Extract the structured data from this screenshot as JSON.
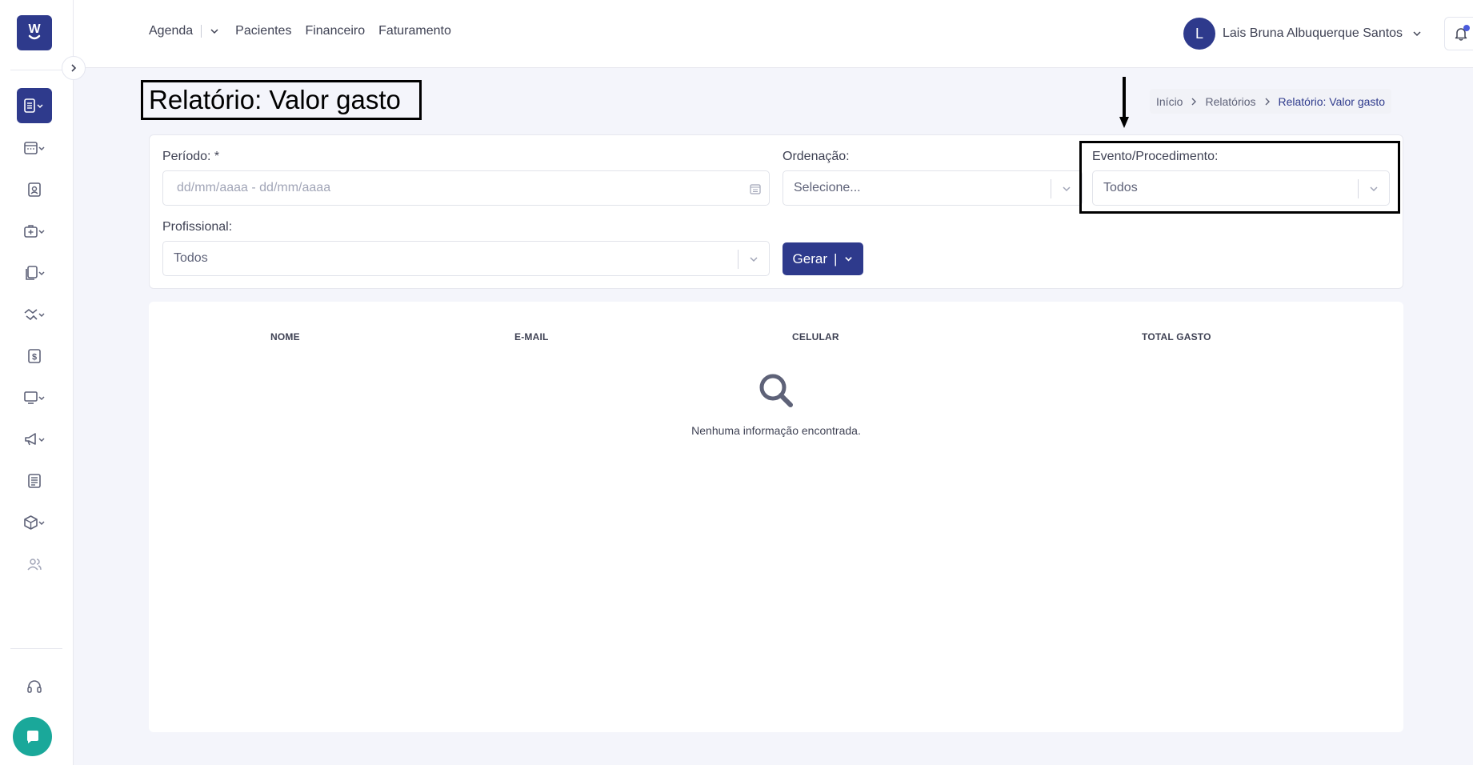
{
  "sidebar": {
    "logo_text": "W",
    "items": [
      {
        "icon": "report-icon",
        "active": true
      },
      {
        "icon": "calendar-icon"
      },
      {
        "icon": "patient-card-icon"
      },
      {
        "icon": "medical-case-icon"
      },
      {
        "icon": "documents-icon"
      },
      {
        "icon": "handshake-icon"
      },
      {
        "icon": "dollar-icon"
      },
      {
        "icon": "monitor-icon"
      },
      {
        "icon": "megaphone-icon"
      },
      {
        "icon": "newspaper-icon"
      },
      {
        "icon": "box-icon"
      },
      {
        "icon": "users-icon"
      }
    ],
    "support_icon": "headset-icon",
    "chat_icon": "chat-icon"
  },
  "header": {
    "nav": {
      "agenda": "Agenda",
      "pacientes": "Pacientes",
      "financeiro": "Financeiro",
      "faturamento": "Faturamento"
    },
    "user": {
      "initial": "L",
      "name": "Lais Bruna Albuquerque Santos"
    }
  },
  "page": {
    "title": "Relatório: Valor gasto",
    "breadcrumb": [
      "Início",
      "Relatórios",
      "Relatório: Valor gasto"
    ]
  },
  "filters": {
    "periodo_label": "Período: *",
    "periodo_placeholder": "dd/mm/aaaa - dd/mm/aaaa",
    "ordenacao_label": "Ordenação:",
    "ordenacao_value": "Selecione...",
    "evento_label": "Evento/Procedimento:",
    "evento_value": "Todos",
    "profissional_label": "Profissional:",
    "profissional_value": "Todos",
    "gerar_label": "Gerar",
    "gerar_sep": "|"
  },
  "table": {
    "columns": [
      "NOME",
      "E-MAIL",
      "CELULAR",
      "TOTAL GASTO"
    ],
    "empty_message": "Nenhuma informação encontrada."
  },
  "colors": {
    "primary": "#2e3a8c",
    "chat": "#1aa89a",
    "background": "#f4f5fb"
  }
}
